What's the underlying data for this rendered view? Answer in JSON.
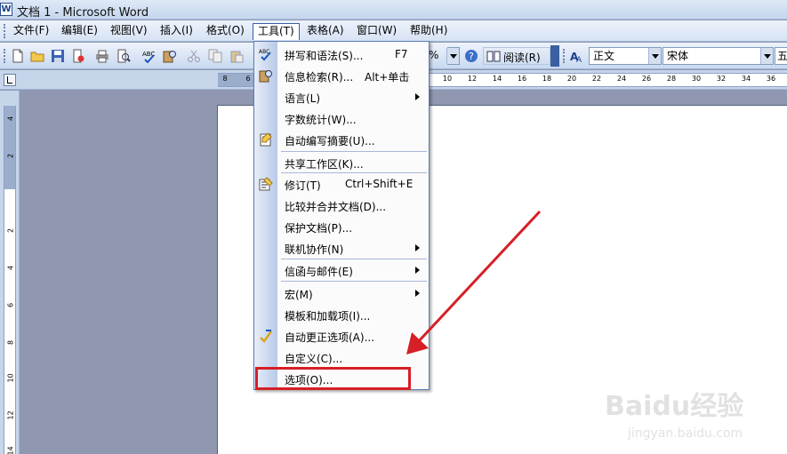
{
  "window": {
    "title": "文档 1 - Microsoft Word",
    "app_icon_glyph": "W"
  },
  "menubar": {
    "items": [
      {
        "label": "文件(F)"
      },
      {
        "label": "编辑(E)"
      },
      {
        "label": "视图(V)"
      },
      {
        "label": "插入(I)"
      },
      {
        "label": "格式(O)"
      },
      {
        "label": "工具(T)"
      },
      {
        "label": "表格(A)"
      },
      {
        "label": "窗口(W)"
      },
      {
        "label": "帮助(H)"
      }
    ]
  },
  "toolbar": {
    "zoom_fragment": "%",
    "read_button": "阅读(R)",
    "style_value": "正文",
    "font_value": "宋体",
    "size_value": "五",
    "style_icon": "AA-style-icon"
  },
  "ruler": {
    "h_numbers": [
      "8",
      "6",
      "10",
      "12",
      "14",
      "16",
      "18",
      "20",
      "22",
      "24",
      "26",
      "28",
      "30",
      "32",
      "34",
      "36"
    ],
    "v_numbers": [
      "4",
      "2",
      "2",
      "4",
      "6",
      "8",
      "10",
      "12",
      "14"
    ]
  },
  "dropdown": {
    "items": [
      {
        "label": "拼写和语法(S)...",
        "shortcut": "F7",
        "icon": "spelling-icon"
      },
      {
        "label": "信息检索(R)...",
        "shortcut": "Alt+单击",
        "icon": "research-icon"
      },
      {
        "label": "语言(L)",
        "submenu": true
      },
      {
        "label": "字数统计(W)..."
      },
      {
        "label": "自动编写摘要(U)...",
        "icon": "autosummarize-icon"
      },
      {
        "label": "共享工作区(K)..."
      },
      {
        "label": "修订(T)",
        "shortcut": "Ctrl+Shift+E",
        "icon": "track-changes-icon"
      },
      {
        "label": "比较并合并文档(D)..."
      },
      {
        "label": "保护文档(P)..."
      },
      {
        "label": "联机协作(N)",
        "submenu": true
      },
      {
        "label": "信函与邮件(E)",
        "submenu": true
      },
      {
        "label": "宏(M)",
        "submenu": true
      },
      {
        "label": "模板和加载项(I)..."
      },
      {
        "label": "自动更正选项(A)...",
        "icon": "autocorrect-icon"
      },
      {
        "label": "自定义(C)..."
      },
      {
        "label": "选项(O)..."
      }
    ]
  },
  "annotation": {
    "highlight_color": "#d61f26",
    "arrow_color": "#d61f26"
  },
  "watermark": {
    "brand": "Baidu经验",
    "url": "jingyan.baidu.com"
  }
}
